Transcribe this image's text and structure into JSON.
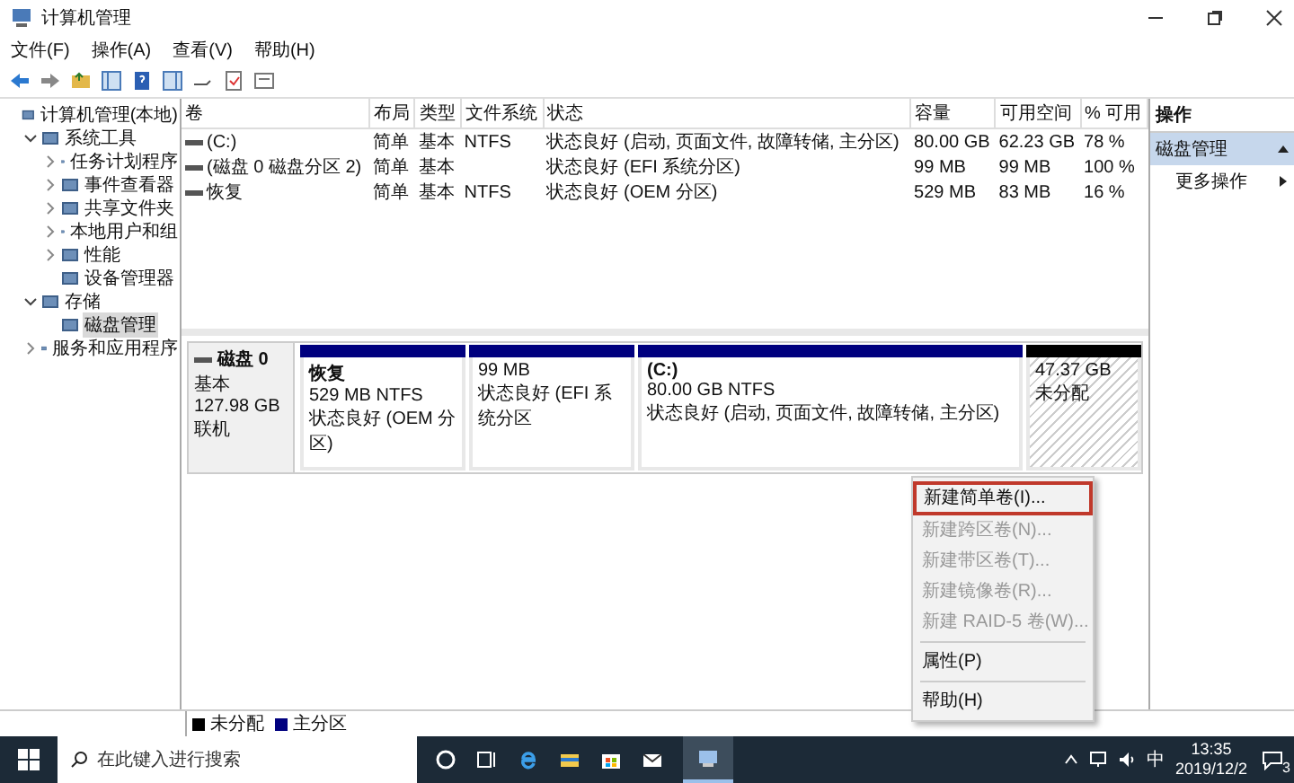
{
  "window": {
    "title": "计算机管理"
  },
  "menu": [
    "文件(F)",
    "操作(A)",
    "查看(V)",
    "帮助(H)"
  ],
  "tree": [
    {
      "label": "计算机管理(本地)",
      "selected": false,
      "children": [
        {
          "label": "系统工具",
          "selected": false,
          "expanded": true,
          "children": [
            {
              "label": "任务计划程序",
              "selected": false,
              "expanded": false
            },
            {
              "label": "事件查看器",
              "selected": false,
              "expanded": false
            },
            {
              "label": "共享文件夹",
              "selected": false,
              "expanded": false
            },
            {
              "label": "本地用户和组",
              "selected": false,
              "expanded": false
            },
            {
              "label": "性能",
              "selected": false,
              "expanded": false
            },
            {
              "label": "设备管理器",
              "selected": false
            }
          ]
        },
        {
          "label": "存储",
          "selected": false,
          "expanded": true,
          "children": [
            {
              "label": "磁盘管理",
              "selected": true
            }
          ]
        },
        {
          "label": "服务和应用程序",
          "selected": false,
          "expanded": false
        }
      ]
    }
  ],
  "table": {
    "columns": [
      "卷",
      "布局",
      "类型",
      "文件系统",
      "状态",
      "容量",
      "可用空间",
      "% 可用"
    ],
    "rows": [
      [
        "(C:)",
        "简单",
        "基本",
        "NTFS",
        "状态良好 (启动, 页面文件, 故障转储, 主分区)",
        "80.00 GB",
        "62.23 GB",
        "78 %"
      ],
      [
        "(磁盘 0 磁盘分区 2)",
        "简单",
        "基本",
        "",
        "状态良好 (EFI 系统分区)",
        "99 MB",
        "99 MB",
        "100 %"
      ],
      [
        "恢复",
        "简单",
        "基本",
        "NTFS",
        "状态良好 (OEM 分区)",
        "529 MB",
        "83 MB",
        "16 %"
      ]
    ]
  },
  "disk": {
    "name": "磁盘 0",
    "type": "基本",
    "size": "127.98 GB",
    "status": "联机",
    "partitions": [
      {
        "kind": "primary",
        "color": "#00007f",
        "title": "恢复",
        "size": "529 MB NTFS",
        "status": "状态良好 (OEM 分区)"
      },
      {
        "kind": "primary",
        "color": "#00007f",
        "size": "99 MB",
        "status": "状态良好 (EFI 系统分区"
      },
      {
        "kind": "primary",
        "color": "#00007f",
        "title": "(C:)",
        "size": "80.00 GB NTFS",
        "status": "状态良好 (启动, 页面文件, 故障转储, 主分区)"
      },
      {
        "kind": "unallocated",
        "color": "#000000",
        "size": "47.37 GB",
        "status": "未分配"
      }
    ]
  },
  "context_menu": [
    {
      "kind": "item",
      "label": "新建简单卷(I)...",
      "disabled": false,
      "highlighted": true
    },
    {
      "kind": "item",
      "label": "新建跨区卷(N)...",
      "disabled": true,
      "highlighted": false
    },
    {
      "kind": "item",
      "label": "新建带区卷(T)...",
      "disabled": true,
      "highlighted": false
    },
    {
      "kind": "item",
      "label": "新建镜像卷(R)...",
      "disabled": true,
      "highlighted": false
    },
    {
      "kind": "item",
      "label": "新建 RAID-5 卷(W)...",
      "disabled": true,
      "highlighted": false
    },
    {
      "kind": "separator"
    },
    {
      "kind": "item",
      "label": "属性(P)",
      "disabled": false,
      "highlighted": false
    },
    {
      "kind": "separator"
    },
    {
      "kind": "item",
      "label": "帮助(H)",
      "disabled": false,
      "highlighted": false
    }
  ],
  "legend": [
    {
      "label": "未分配",
      "color": "#000000"
    },
    {
      "label": "主分区",
      "color": "#00007f"
    }
  ],
  "actions": {
    "header": "操作",
    "section": "磁盘管理",
    "items": [
      "更多操作"
    ]
  },
  "taskbar": {
    "search": {
      "placeholder": "在此键入进行搜索"
    },
    "ime": "中",
    "time": "13:35",
    "date": "2019/12/2",
    "notifications": "3"
  }
}
